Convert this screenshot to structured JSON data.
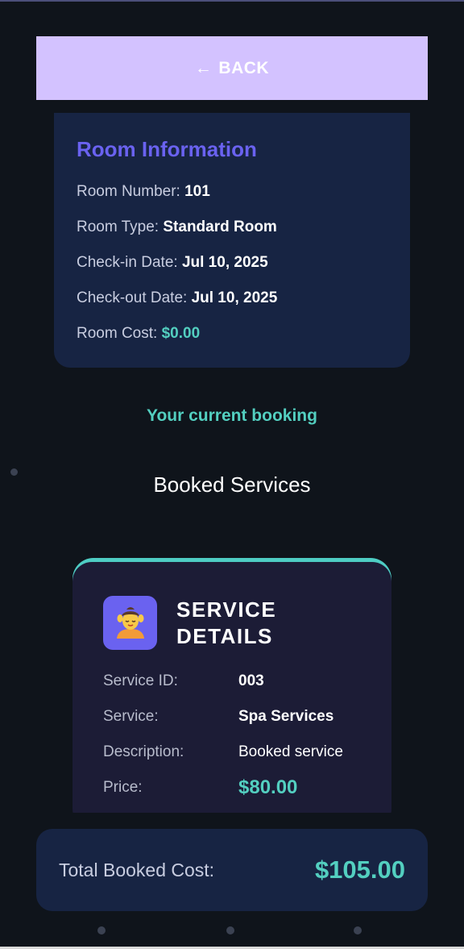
{
  "back_button": {
    "arrow": "←",
    "label": "BACK"
  },
  "room_info": {
    "title": "Room Information",
    "rows": [
      {
        "label": "Room Number:",
        "value": "101"
      },
      {
        "label": "Room Type:",
        "value": "Standard Room"
      },
      {
        "label": "Check-in Date:",
        "value": "Jul 10, 2025"
      },
      {
        "label": "Check-out Date:",
        "value": "Jul 10, 2025"
      },
      {
        "label": "Room Cost:",
        "value": "$0.00"
      }
    ]
  },
  "current_booking_label": "Your current booking",
  "booked_services_title": "Booked Services",
  "service_card": {
    "icon": "spa-massage-icon",
    "title_line1": "SERVICE",
    "title_line2": "DETAILS",
    "rows": [
      {
        "label": "Service ID:",
        "value": "003"
      },
      {
        "label": "Service:",
        "value": "Spa Services"
      },
      {
        "label": "Description:",
        "value": "Booked service"
      },
      {
        "label": "Price:",
        "value": "$80.00"
      }
    ]
  },
  "total": {
    "label": "Total Booked Cost:",
    "value": "$105.00"
  },
  "colors": {
    "background": "#0f141b",
    "back_button": "#d3c2ff",
    "card": "#172443",
    "accent_purple": "#6a62f0",
    "accent_teal": "#53cfc0"
  }
}
